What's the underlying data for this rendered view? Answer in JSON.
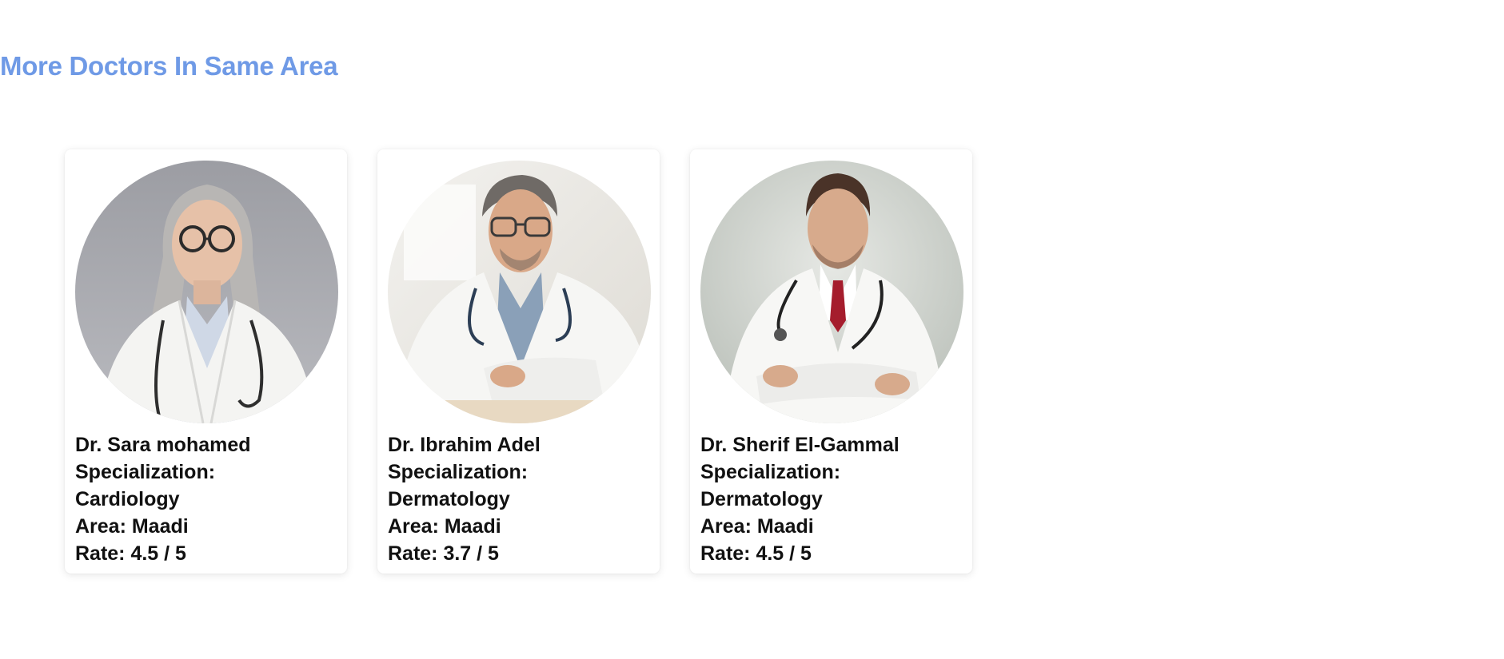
{
  "section": {
    "title": "More Doctors In Same Area"
  },
  "doctors": [
    {
      "name": "Dr. Sara mohamed",
      "specialization_label": "Specialization:",
      "specialization": "Cardiology",
      "area": "Area: Maadi",
      "rate": "Rate: 4.5 / 5",
      "photo": "female-doctor-portrait"
    },
    {
      "name": "Dr. Ibrahim Adel",
      "specialization_label": "Specialization:",
      "specialization": "Dermatology",
      "area": "Area: Maadi",
      "rate": "Rate: 3.7 / 5",
      "photo": "male-doctor-smiling-portrait"
    },
    {
      "name": "Dr. Sherif El-Gammal",
      "specialization_label": "Specialization:",
      "specialization": "Dermatology",
      "area": "Area: Maadi",
      "rate": "Rate: 4.5 / 5",
      "photo": "male-doctor-arms-crossed-portrait"
    }
  ],
  "colors": {
    "title": "#6f9ae6",
    "text": "#111111",
    "card_bg": "#ffffff"
  }
}
